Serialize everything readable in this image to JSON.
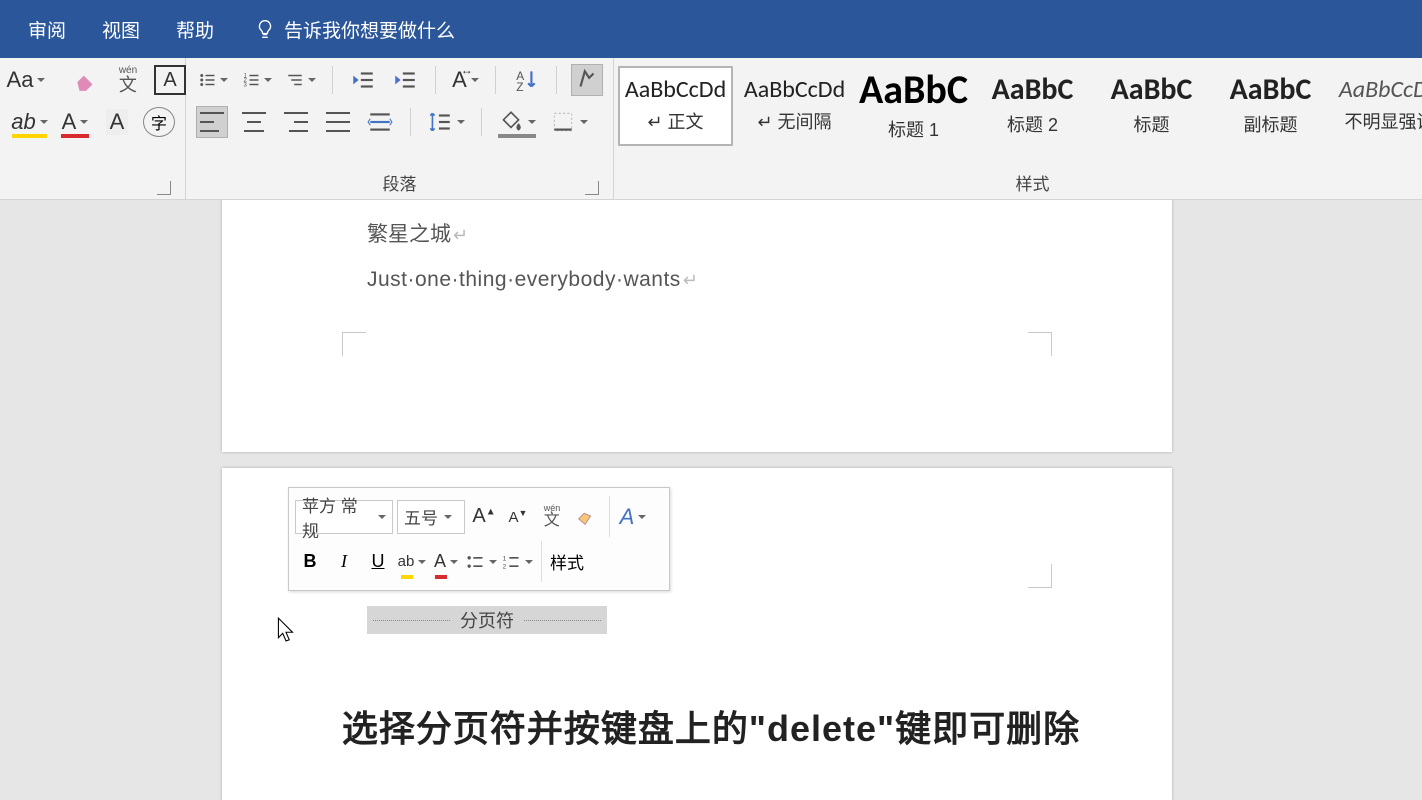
{
  "tabs": {
    "review": "审阅",
    "view": "视图",
    "help": "帮助"
  },
  "tell_me": "告诉我你想要做什么",
  "ribbon": {
    "paragraph_label": "段落",
    "style_label": "样式"
  },
  "styles": [
    {
      "preview": "AaBbCcDd",
      "name": "↵ 正文",
      "cls": "sp0",
      "selected": true
    },
    {
      "preview": "AaBbCcDd",
      "name": "↵ 无间隔",
      "cls": "sp1"
    },
    {
      "preview": "AaBbC",
      "name": "标题 1",
      "cls": "sp2"
    },
    {
      "preview": "AaBbC",
      "name": "标题 2",
      "cls": "sp3"
    },
    {
      "preview": "AaBbC",
      "name": "标题",
      "cls": "sp4"
    },
    {
      "preview": "AaBbC",
      "name": "副标题",
      "cls": "sp5"
    },
    {
      "preview": "AaBbCcDd",
      "name": "不明显强调",
      "cls": "sp6"
    }
  ],
  "doc": {
    "line1": "繁星之城",
    "line2": "Just·one·thing·everybody·wants",
    "page_break": "分页符"
  },
  "mini": {
    "font": "苹方 常规",
    "size": "五号",
    "style_btn": "样式"
  },
  "caption": "选择分页符并按键盘上的\"delete\"键即可删除"
}
